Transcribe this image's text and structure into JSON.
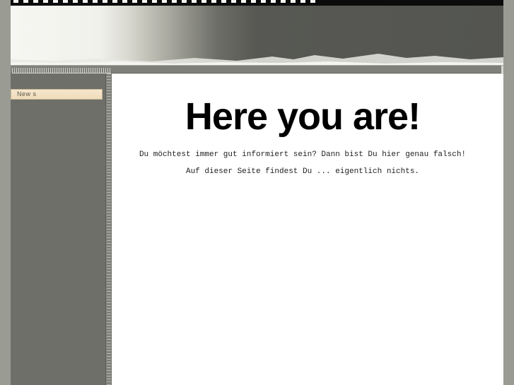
{
  "sidebar": {
    "items": [
      {
        "label": "New s"
      }
    ]
  },
  "main": {
    "heading": "Here you are!",
    "paragraphs": [
      "Du möchtest immer gut informiert sein? Dann bist Du hier genau falsch!",
      "Auf dieser Seite findest Du ... eigentlich nichts."
    ]
  },
  "colors": {
    "page_background": "#9a9b93",
    "sidebar": "#6e6f68",
    "nav_item": "#f2e0c2",
    "content_background": "#ffffff",
    "header_dark": "#545551"
  },
  "icons": [
    "filmstrip-decoration",
    "ruler-decoration"
  ]
}
